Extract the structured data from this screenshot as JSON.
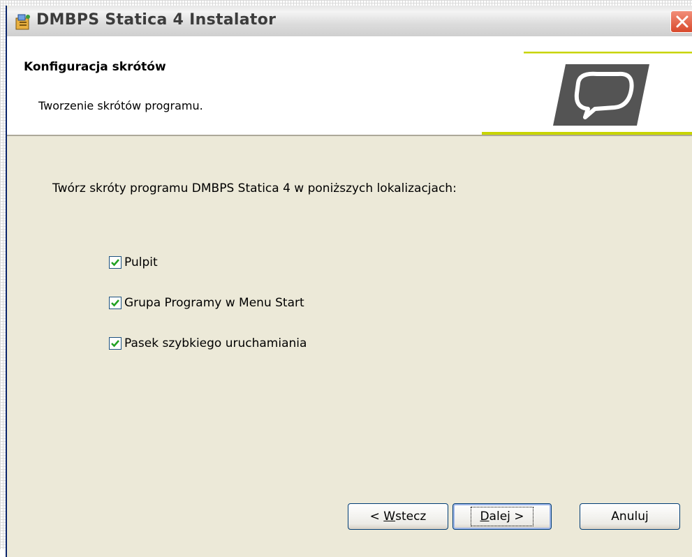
{
  "window": {
    "title": "DMBPS Statica 4 Instalator",
    "title_icon": "installer-icon",
    "close_icon": "close-icon"
  },
  "banner": {
    "title": "Konfiguracja skrótów",
    "subtitle": "Tworzenie skrótów programu.",
    "logo": "dmbps-logo"
  },
  "main": {
    "instruction": "Twórz skróty programu DMBPS Statica 4 w poniższych lokalizacjach:",
    "options": [
      {
        "label": "Pulpit",
        "checked": true
      },
      {
        "label": "Grupa Programy w Menu Start",
        "checked": true
      },
      {
        "label": "Pasek szybkiego uruchamiania",
        "checked": true
      }
    ]
  },
  "buttons": {
    "back_prefix": "< ",
    "back_mnemonic": "W",
    "back_rest": "stecz",
    "next_mnemonic": "D",
    "next_rest": "alej >",
    "cancel": "Anuluj"
  },
  "colors": {
    "dialog_bg": "#ECE9D8",
    "accent_green": "#C8D400",
    "check_green": "#21A121",
    "close_red": "#D8492C"
  }
}
